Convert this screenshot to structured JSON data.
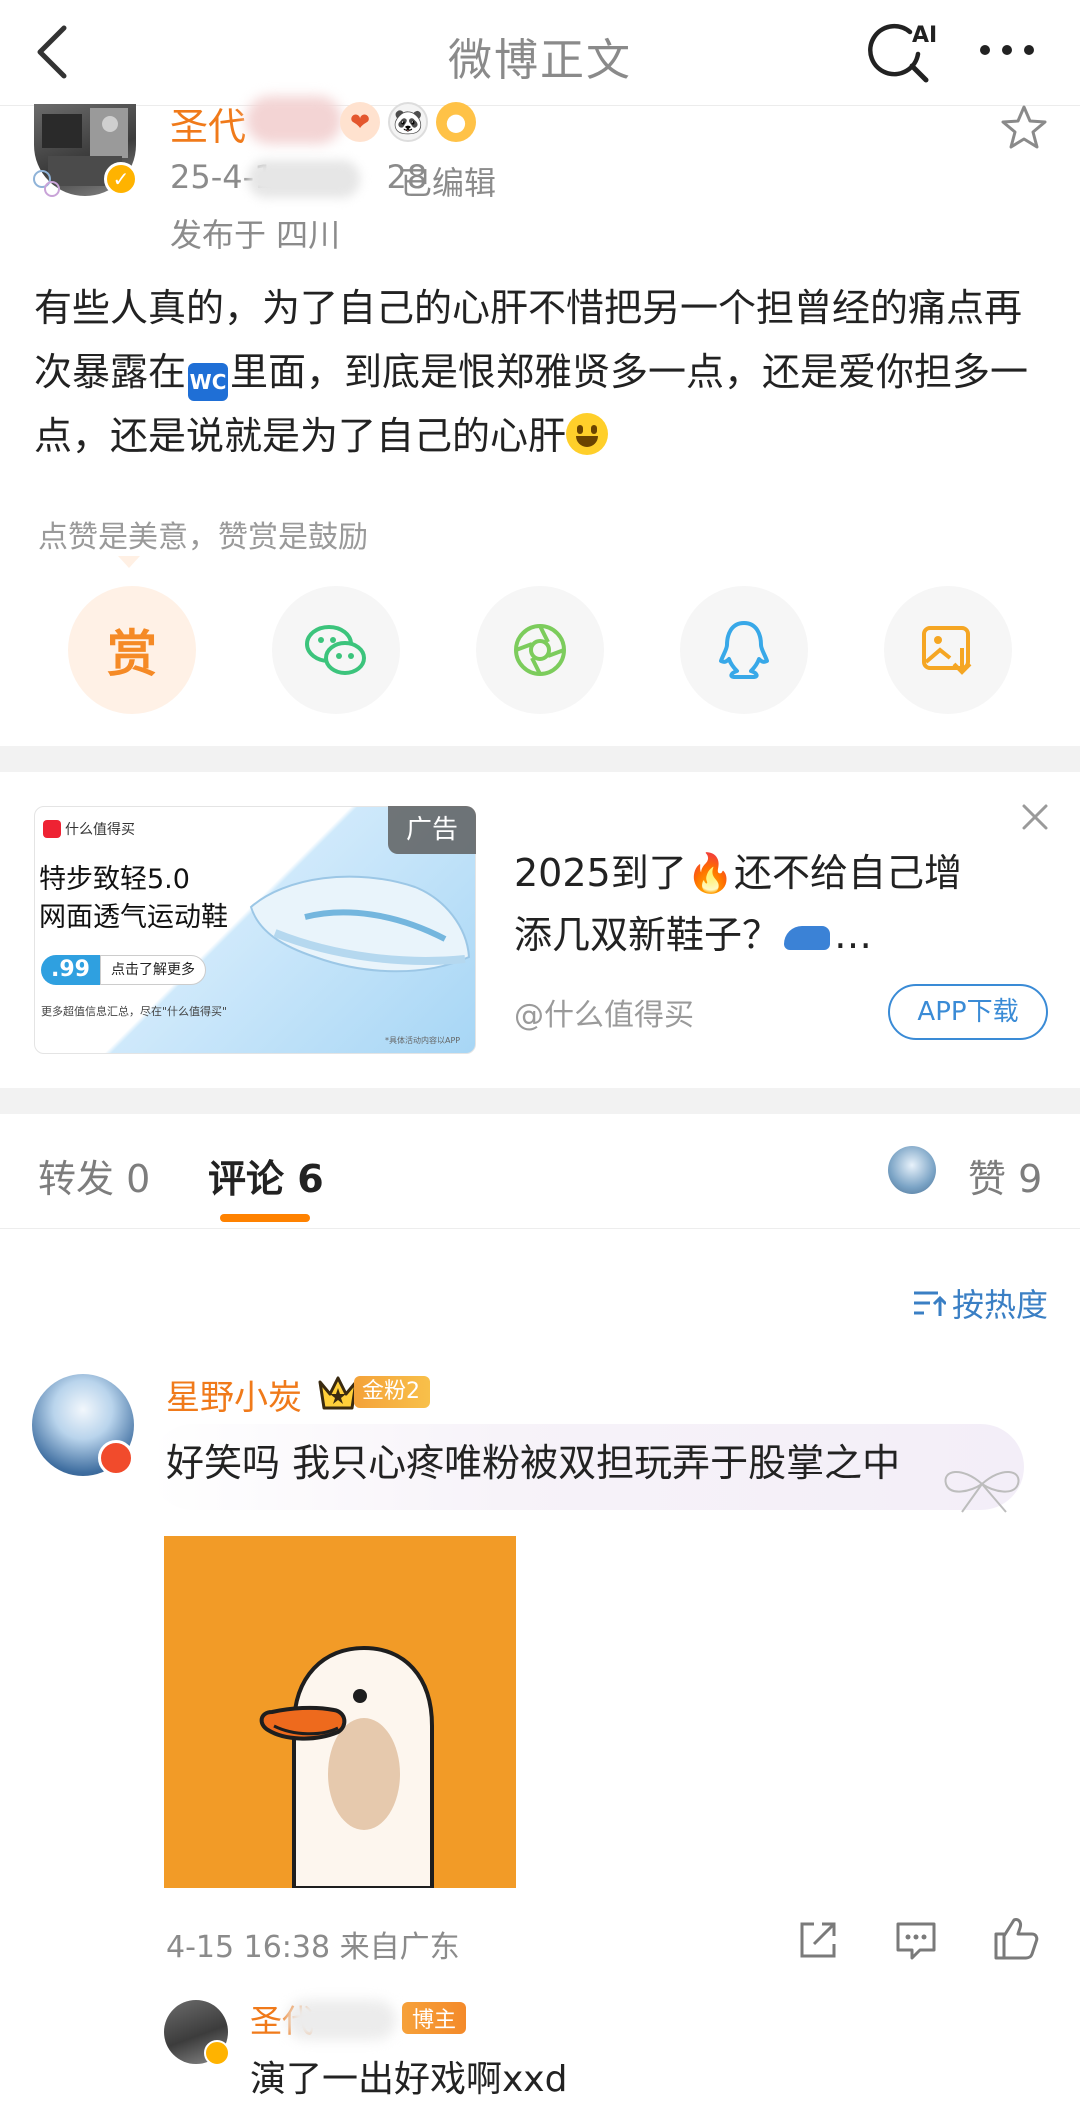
{
  "nav": {
    "title": "微博正文",
    "ai_label": "AI"
  },
  "post": {
    "author_name_visible": "圣代",
    "time_prefix": "25-4-1",
    "time_suffix": "28",
    "edited": "已编辑",
    "location": "发布于 四川",
    "text_part1": "有些人真的，为了自己的心肝不惜把另一个担曾经的痛点再次暴露在",
    "wc_glyph": "WC",
    "text_part2": "里面，到底是恨郑雅贤多一点，还是爱你担多一点，还是说就是为了自己的心肝"
  },
  "reward": {
    "hint": "点赞是美意，赞赏是鼓励",
    "reward_label": "赏"
  },
  "ad": {
    "label": "广告",
    "image_brand": "什么值得买",
    "image_title_line1": "特步致轻5.0",
    "image_title_line2": "网面透气运动鞋",
    "image_price": ".99",
    "image_cta": "点击了解更多",
    "image_footer": "更多超值信息汇总，尽在\"什么值得买\"",
    "image_note": "*具体活动内容以APP",
    "text_line1": "2025到了",
    "text_line1b": "还不给自己增",
    "text_line2": "添几双新鞋子？",
    "text_ellipsis": "…",
    "source": "@什么值得买",
    "download": "APP下载"
  },
  "tabs": {
    "repost": "转发 0",
    "comments": "评论 6",
    "likes": "赞 9"
  },
  "sort": {
    "label": "按热度"
  },
  "comment": {
    "name": "星野小炭",
    "fan_badge": "金粉2",
    "text": "好笑吗 我只心疼唯粉被双担玩弄于股掌之中",
    "meta": "4-15 16:38 来自广东"
  },
  "reply": {
    "name_visible": "圣代",
    "owner_badge": "博主",
    "text": "演了一出好戏啊xxd"
  },
  "colors": {
    "accent_orange": "#ff8200",
    "name_orange": "#f07a1a",
    "link_blue": "#3a7fc4",
    "wechat_green": "#3cc47c",
    "qq_blue": "#38a8e8",
    "save_orange": "#f5a623"
  },
  "icons": {
    "back": "chevron-left-icon",
    "ai_search": "ai-search-icon",
    "more": "more-dots-icon",
    "favorite": "star-icon",
    "wechat": "wechat-icon",
    "moments": "moments-icon",
    "qq": "qq-icon",
    "save_image": "save-image-icon",
    "sort": "sort-icon",
    "share": "share-icon",
    "reply": "comment-icon",
    "like": "thumbs-up-icon"
  }
}
